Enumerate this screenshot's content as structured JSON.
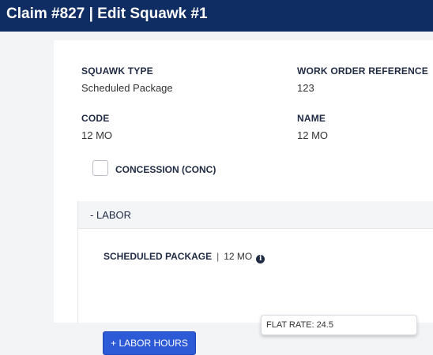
{
  "header": {
    "title": "Claim #827 | Edit Squawk #1"
  },
  "form": {
    "squawk_type": {
      "label": "SQUAWK TYPE",
      "value": "Scheduled Package"
    },
    "work_order_reference": {
      "label": "WORK ORDER REFERENCE",
      "value": "123"
    },
    "code": {
      "label": "CODE",
      "value": "12 MO"
    },
    "name": {
      "label": "NAME",
      "value": "12 MO"
    },
    "concession": {
      "label": "CONCESSION (CONC)",
      "checked": false
    }
  },
  "labor": {
    "toggle_label": "- LABOR",
    "package_title": "SCHEDULED PACKAGE",
    "separator": "|",
    "package_value": "12 MO",
    "info_icon": "info-icon",
    "tooltip_text": "FLAT RATE: 24.5",
    "add_hours_label": "+ LABOR HOURS"
  },
  "colors": {
    "header_bg": "#0f2d63",
    "button_bg": "#2d5ad6"
  }
}
